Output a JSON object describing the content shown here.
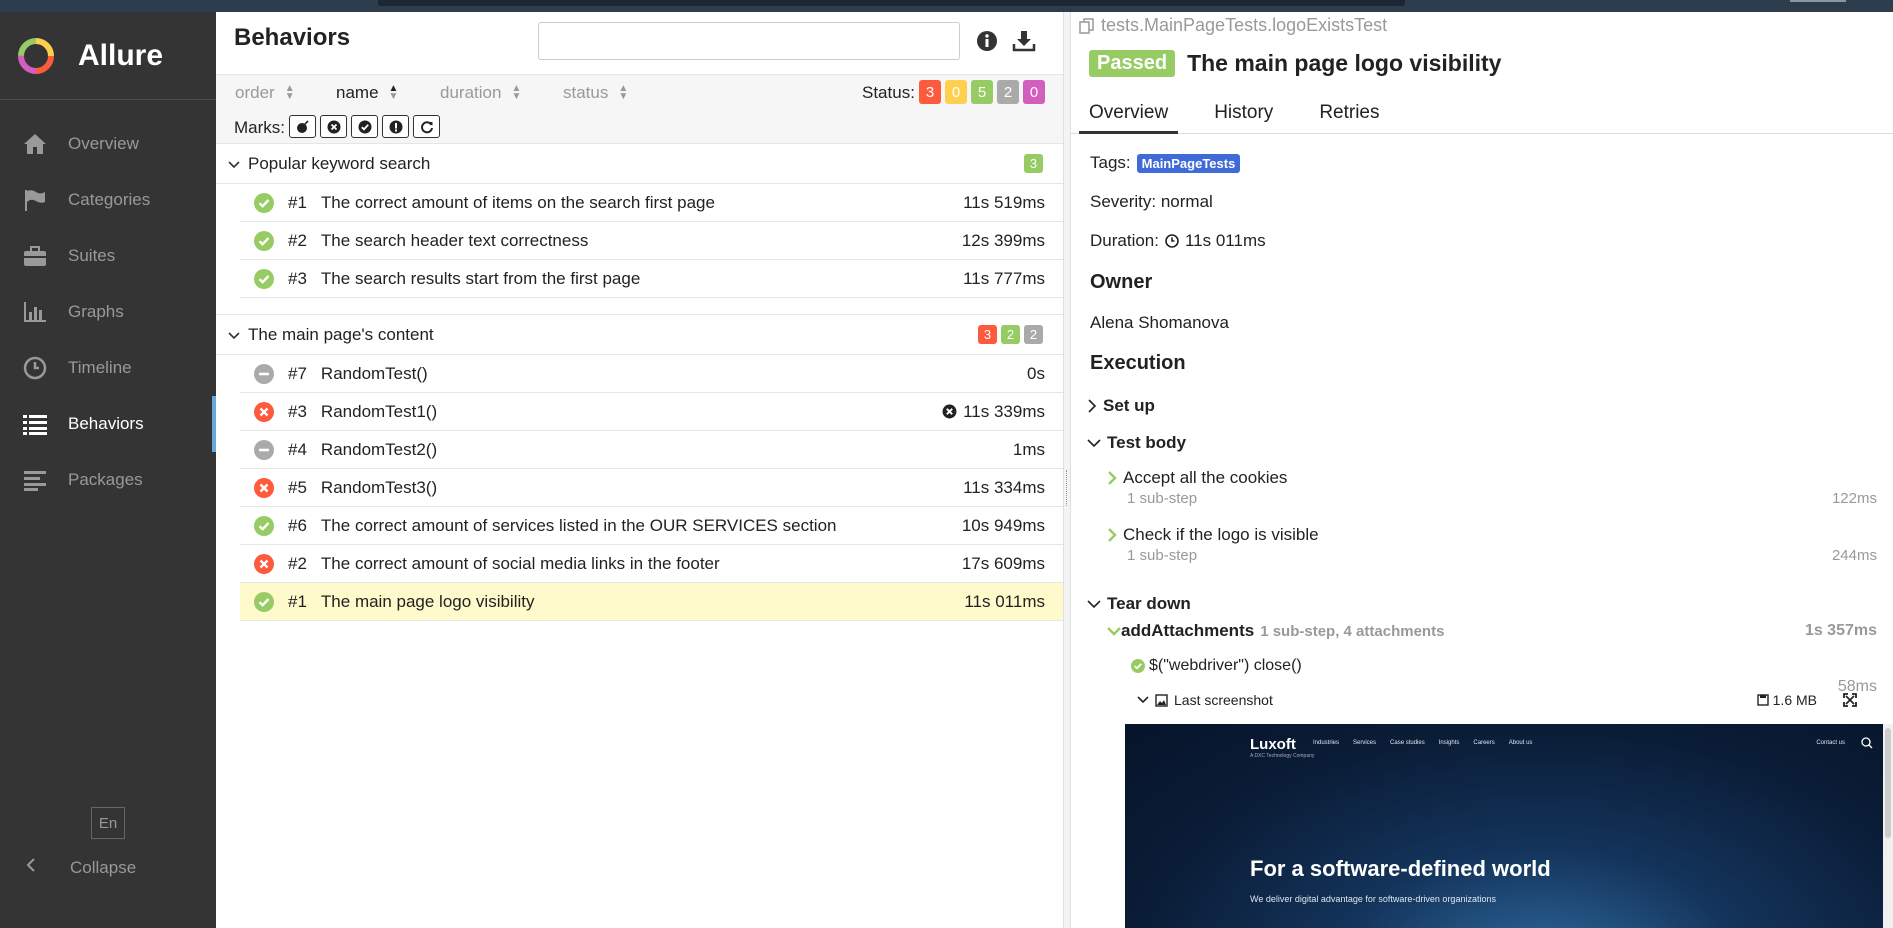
{
  "app": {
    "name": "Allure"
  },
  "sidebar": {
    "items": [
      {
        "label": "Overview",
        "icon": "home-icon"
      },
      {
        "label": "Categories",
        "icon": "flag-icon"
      },
      {
        "label": "Suites",
        "icon": "briefcase-icon"
      },
      {
        "label": "Graphs",
        "icon": "bar-chart-icon"
      },
      {
        "label": "Timeline",
        "icon": "clock-icon"
      },
      {
        "label": "Behaviors",
        "icon": "list-icon",
        "active": true
      },
      {
        "label": "Packages",
        "icon": "align-left-icon"
      }
    ],
    "language": "En",
    "collapse": "Collapse"
  },
  "behaviors": {
    "title": "Behaviors",
    "search_value": "",
    "sort": {
      "order": "order",
      "name": "name",
      "duration": "duration",
      "status": "status"
    },
    "status_label": "Status:",
    "status_counts": {
      "failed": "3",
      "broken": "0",
      "passed": "5",
      "skipped": "2",
      "unknown": "0"
    },
    "marks_label": "Marks:",
    "groups": [
      {
        "name": "Popular keyword search",
        "counts": [
          {
            "status": "passed",
            "value": "3"
          }
        ],
        "rows": [
          {
            "status": "passed",
            "num": "#1",
            "name": "The correct amount of items on the search first page",
            "duration": "11s 519ms"
          },
          {
            "status": "passed",
            "num": "#2",
            "name": "The search header text correctness",
            "duration": "12s 399ms"
          },
          {
            "status": "passed",
            "num": "#3",
            "name": "The search results start from the first page",
            "duration": "11s 777ms"
          }
        ]
      },
      {
        "name": "The main page's content",
        "counts": [
          {
            "status": "failed",
            "value": "3"
          },
          {
            "status": "passed",
            "value": "2"
          },
          {
            "status": "skipped",
            "value": "2"
          }
        ],
        "rows": [
          {
            "status": "skipped",
            "num": "#7",
            "name": "RandomTest()",
            "duration": "0s"
          },
          {
            "status": "failed",
            "num": "#3",
            "name": "RandomTest1()",
            "duration": "11s 339ms",
            "flag": true
          },
          {
            "status": "skipped",
            "num": "#4",
            "name": "RandomTest2()",
            "duration": "1ms"
          },
          {
            "status": "failed",
            "num": "#5",
            "name": "RandomTest3()",
            "duration": "11s 334ms"
          },
          {
            "status": "passed",
            "num": "#6",
            "name": "The correct amount of services listed in the OUR SERVICES section",
            "duration": "10s 949ms"
          },
          {
            "status": "failed",
            "num": "#2",
            "name": "The correct amount of social media links in the footer",
            "duration": "17s 609ms"
          },
          {
            "status": "passed",
            "num": "#1",
            "name": "The main page logo visibility",
            "duration": "11s 011ms",
            "selected": true
          }
        ]
      }
    ]
  },
  "result": {
    "path": "tests.MainPageTests.logoExistsTest",
    "status": "Passed",
    "title": "The main page logo visibility",
    "tabs": [
      "Overview",
      "History",
      "Retries"
    ],
    "tags_label": "Tags:",
    "tag": "MainPageTests",
    "severity": "Severity: normal",
    "duration_label": "Duration:",
    "duration": "11s 011ms",
    "owner_heading": "Owner",
    "owner": "Alena Shomanova",
    "execution_heading": "Execution",
    "setup": "Set up",
    "test_body": "Test body",
    "steps": [
      {
        "name": "Accept all the cookies",
        "sub": "1 sub-step",
        "time": "122ms"
      },
      {
        "name": "Check if the logo is visible",
        "sub": "1 sub-step",
        "time": "244ms"
      }
    ],
    "teardown": "Tear down",
    "attach": {
      "name": "addAttachments",
      "meta": "1 sub-step, 4 attachments",
      "time": "1s 357ms"
    },
    "substep": {
      "name": "$(\"webdriver\") close()",
      "time": "58ms"
    },
    "shot": {
      "name": "Last screenshot",
      "size": "1.6 MB"
    },
    "screenshot": {
      "logo": "Luxoft",
      "logo_sub": "A DXC Technology Company",
      "nav": [
        "Industries",
        "Services",
        "Case studies",
        "Insights",
        "Careers",
        "About us"
      ],
      "contact": "Contact us",
      "headline": "For a software-defined world",
      "subline": "We deliver digital advantage for software-driven organizations"
    }
  },
  "colors": {
    "failed": "#fd5a3e",
    "broken": "#ffd050",
    "passed": "#97cc64",
    "skipped": "#aaaaaa",
    "unknown": "#d35ebe"
  }
}
